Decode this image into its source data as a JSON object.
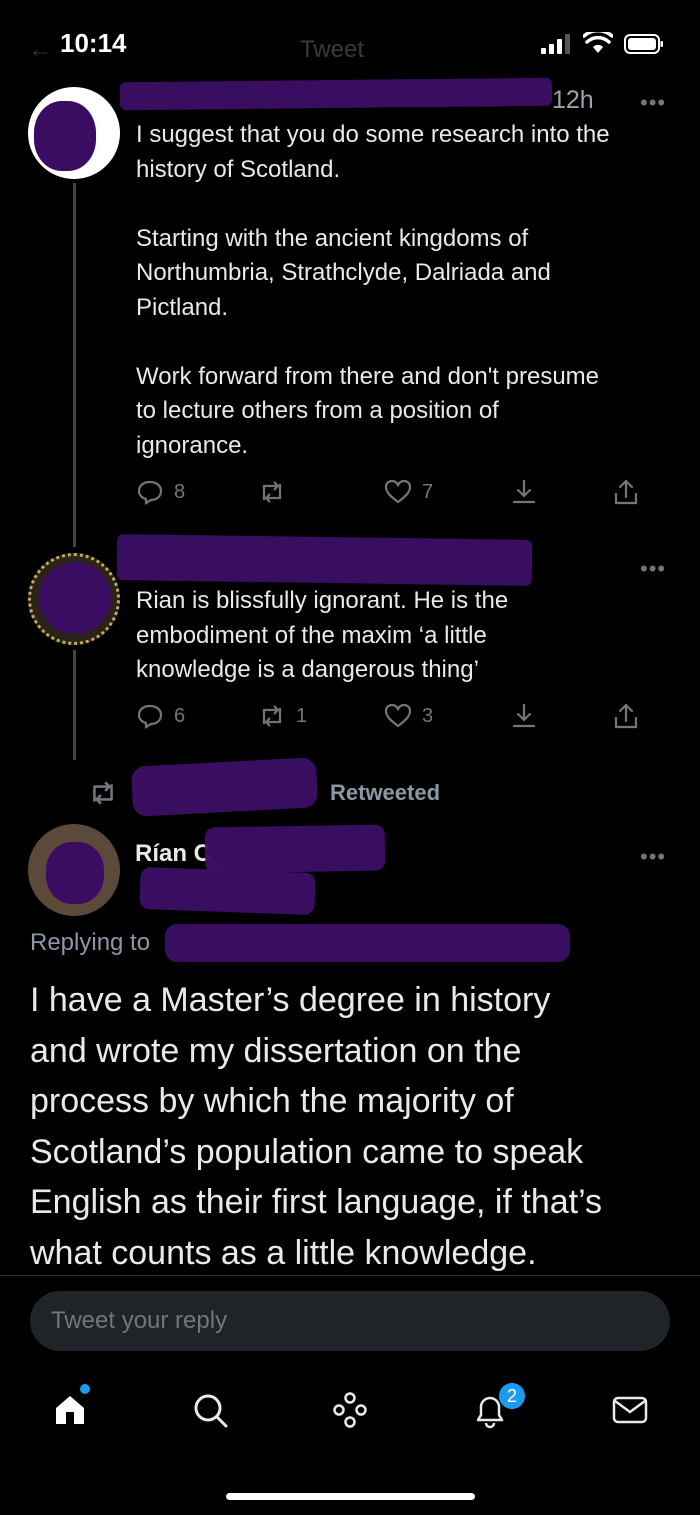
{
  "status_bar": {
    "time": "10:14",
    "faded_title": "Tweet",
    "faded_back": "←"
  },
  "tweet1": {
    "time": "12h",
    "more": "•••",
    "text": "I suggest that you do some research into the\nhistory of Scotland.\n\nStarting with the ancient kingdoms of\nNorthumbria, Strathclyde, Dalriada and\nPictland.\n\nWork forward from there and don't presume\nto lecture others from a position of\nignorance.",
    "replies": "8",
    "retweets": "",
    "likes": "7"
  },
  "tweet2": {
    "more": "•••",
    "text": "Rian is blissfully ignorant. He is the\nembodiment of the maxim ‘a little\nknowledge is a dangerous thing’",
    "replies": "6",
    "retweets": "1",
    "likes": "3"
  },
  "retweeted_label": "Retweeted",
  "main_tweet": {
    "author_name": "Rían C",
    "more": "•••",
    "replying_to": "Replying to",
    "text": "I have a Master’s degree in history\nand wrote my dissertation on the\nprocess by which the majority of\nScotland’s population came to speak\nEnglish as their first language, if that’s\nwhat counts as a little knowledge."
  },
  "reply_box": {
    "placeholder": "Tweet your reply"
  },
  "bottom_nav": {
    "notifications_badge": "2"
  },
  "colors": {
    "accent": "#1d9bf0",
    "redaction": "#3c0f66",
    "muted": "#71767b"
  }
}
